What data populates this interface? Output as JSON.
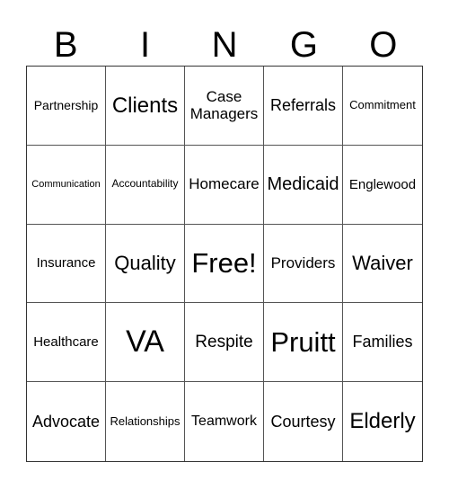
{
  "header": {
    "letters": [
      "B",
      "I",
      "N",
      "G",
      "O"
    ]
  },
  "card": {
    "cells": [
      {
        "text": "Partnership",
        "size": "s"
      },
      {
        "text": "Clients",
        "size": "xl"
      },
      {
        "text": "Case Managers",
        "size": "m"
      },
      {
        "text": "Referrals",
        "size": "l"
      },
      {
        "text": "Commitment",
        "size": "xs"
      },
      {
        "text": "Communication",
        "size": "xxs"
      },
      {
        "text": "Accountability",
        "size": "xxs"
      },
      {
        "text": "Homecare",
        "size": "m"
      },
      {
        "text": "Medicaid",
        "size": "l"
      },
      {
        "text": "Englewood",
        "size": "s"
      },
      {
        "text": "Insurance",
        "size": "s"
      },
      {
        "text": "Quality",
        "size": "xl"
      },
      {
        "text": "Free!",
        "size": "xxl"
      },
      {
        "text": "Providers",
        "size": "m"
      },
      {
        "text": "Waiver",
        "size": "xl"
      },
      {
        "text": "Healthcare",
        "size": "s"
      },
      {
        "text": "VA",
        "size": "xxxl"
      },
      {
        "text": "Respite",
        "size": "l"
      },
      {
        "text": "Pruitt",
        "size": "xxl"
      },
      {
        "text": "Families",
        "size": "l"
      },
      {
        "text": "Advocate",
        "size": "l"
      },
      {
        "text": "Relationships",
        "size": "xs"
      },
      {
        "text": "Teamwork",
        "size": "m"
      },
      {
        "text": "Courtesy",
        "size": "l"
      },
      {
        "text": "Elderly",
        "size": "xl"
      }
    ]
  }
}
